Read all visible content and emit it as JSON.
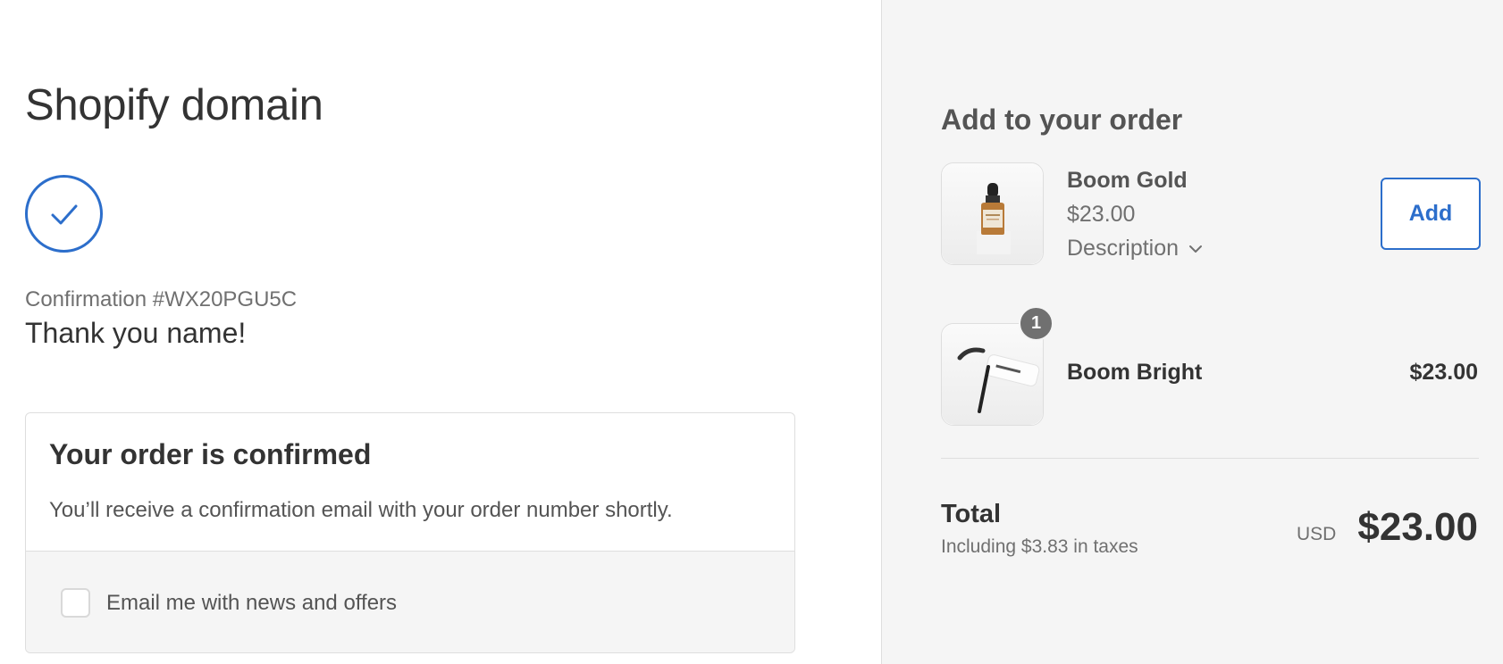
{
  "header": {
    "shop_name": "Shopify domain"
  },
  "confirmation": {
    "number_text": "Confirmation #WX20PGU5C",
    "thanks_text": "Thank you name!"
  },
  "order_card": {
    "heading": "Your order is confirmed",
    "message": "You’ll receive a confirmation email with your order number shortly.",
    "newsletter_label": "Email me with news and offers",
    "newsletter_checked": false
  },
  "upsell": {
    "title": "Add to your order",
    "product": {
      "name": "Boom Gold",
      "price": "$23.00",
      "description_label": "Description",
      "add_label": "Add"
    }
  },
  "order_summary": {
    "items": [
      {
        "name": "Boom Bright",
        "price": "$23.00",
        "quantity": "1"
      }
    ],
    "total_label": "Total",
    "tax_text": "Including $3.83 in taxes",
    "currency": "USD",
    "total_amount": "$23.00"
  },
  "colors": {
    "accent": "#2c6ecb",
    "panel_bg": "#f5f5f5",
    "border": "#dedede"
  },
  "icons": {
    "confirmation": "checkmark-circle-icon",
    "description_toggle": "chevron-down-icon"
  }
}
